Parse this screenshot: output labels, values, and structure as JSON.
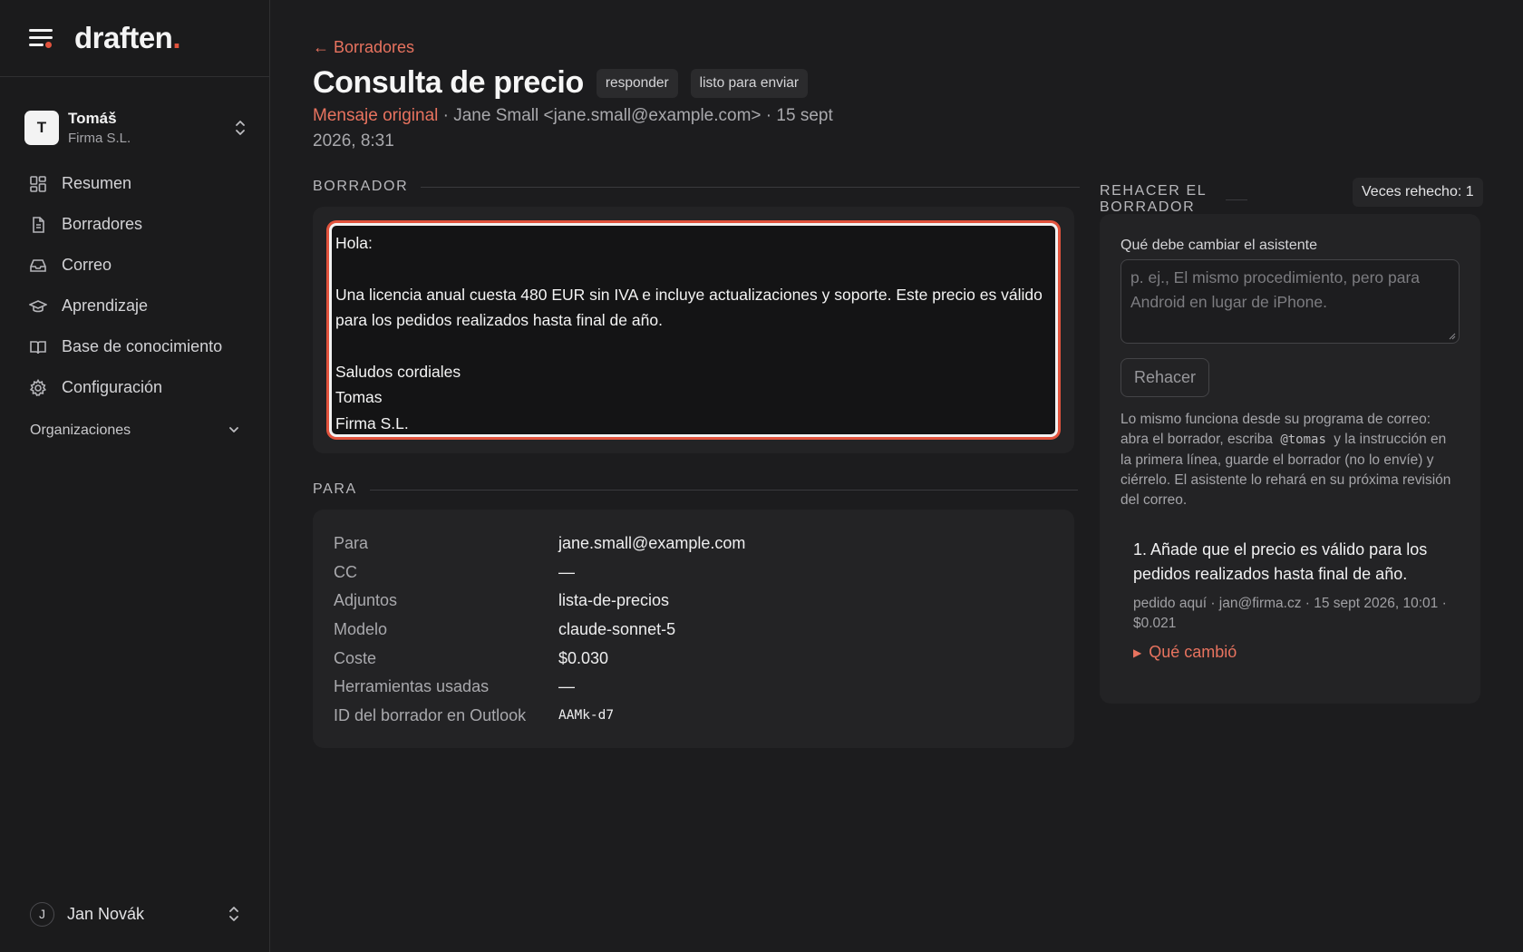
{
  "brand": {
    "logo": "draften",
    "logo_dot": "."
  },
  "org": {
    "initial": "T",
    "name": "Tomáš",
    "company": "Firma S.L."
  },
  "nav": {
    "items": [
      {
        "label": "Resumen",
        "icon": "dashboard-icon"
      },
      {
        "label": "Borradores",
        "icon": "document-icon"
      },
      {
        "label": "Correo",
        "icon": "inbox-icon"
      },
      {
        "label": "Aprendizaje",
        "icon": "graduation-cap-icon"
      },
      {
        "label": "Base de conocimiento",
        "icon": "book-icon"
      },
      {
        "label": "Configuración",
        "icon": "gear-icon"
      }
    ],
    "section_label": "Organizaciones"
  },
  "user": {
    "initial": "J",
    "name": "Jan Novák"
  },
  "header": {
    "back_label": "← Borradores",
    "title": "Consulta de precio",
    "tags": [
      "responder",
      "listo para enviar"
    ],
    "meta_original": "Mensaje original",
    "meta_rest": " · Jane Small <jane.small@example.com> · 15 sept 2026, 8:31"
  },
  "draft": {
    "section_label": "BORRADOR",
    "body": "Hola:\n\nUna licencia anual cuesta 480 EUR sin IVA e incluye actualizaciones y soporte. Este precio es válido para los pedidos realizados hasta final de año.\n\nSaludos cordiales\nTomas\nFirma S.L."
  },
  "para": {
    "section_label": "PARA",
    "rows": [
      {
        "key": "Para",
        "value": "jane.small@example.com"
      },
      {
        "key": "CC",
        "value": "—"
      },
      {
        "key": "Adjuntos",
        "value": "lista-de-precios"
      },
      {
        "key": "Modelo",
        "value": "claude-sonnet-5"
      },
      {
        "key": "Coste",
        "value": "$0.030"
      },
      {
        "key": "Herramientas usadas",
        "value": "—"
      },
      {
        "key": "ID del borrador en Outlook",
        "value": "AAMk-d7"
      }
    ]
  },
  "redo": {
    "section_label": "REHACER EL BORRADOR",
    "count_label": "Veces rehecho: 1",
    "field_label": "Qué debe cambiar el asistente",
    "placeholder": "p. ej., El mismo procedimiento, pero para Android en lugar de iPhone.",
    "button_label": "Rehacer",
    "help_before": "Lo mismo funciona desde su programa de correo: abra el borrador, escriba ",
    "help_code": "@tomas",
    "help_after": " y la instrucción en la primera línea, guarde el borrador (no lo envíe) y ciérrelo. El asistente lo rehará en su próxima revisión del correo.",
    "instruction_title": "1. Añade que el precio es válido para los pedidos realizados hasta final de año.",
    "instruction_meta": "pedido aquí · jan@firma.cz · 15 sept 2026, 10:01 · $0.021",
    "instruction_toggle": "Qué cambió"
  },
  "colors": {
    "accent": "#e8735f",
    "brand_dot": "#e2533d",
    "background": "#1c1c1e",
    "card": "#232325"
  }
}
